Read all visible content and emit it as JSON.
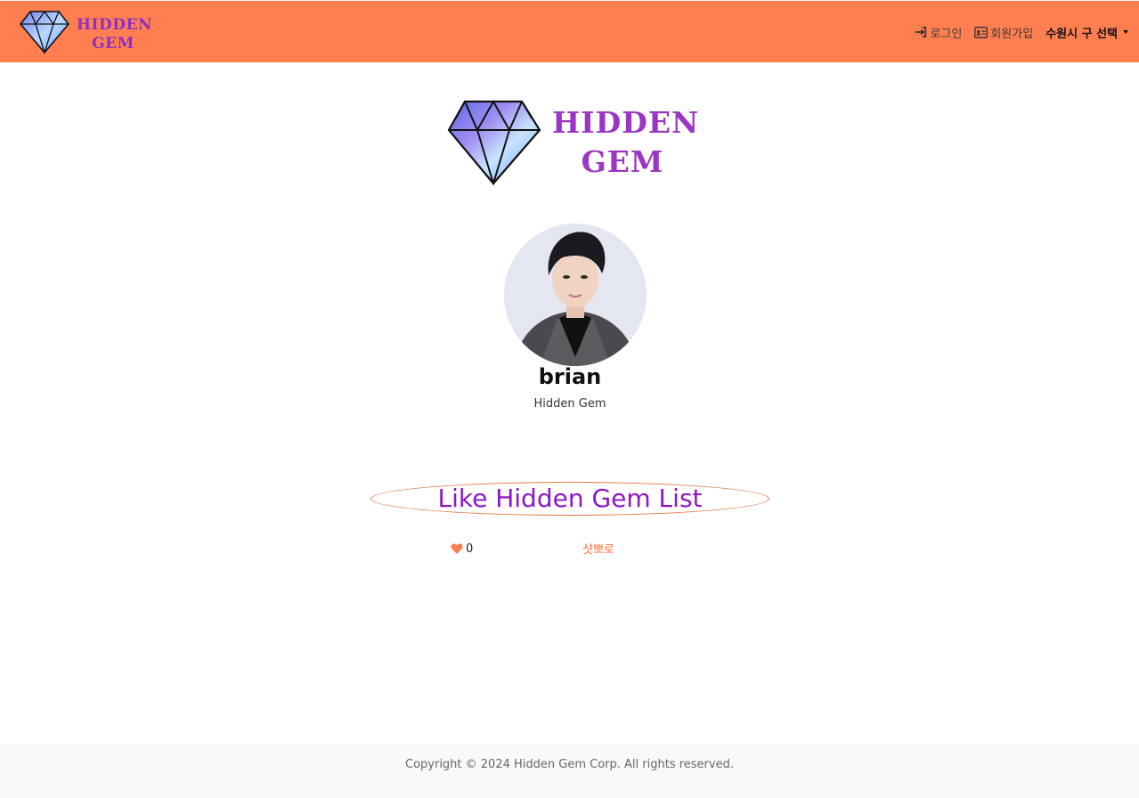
{
  "navbar": {
    "brand_text": "HIDDEN GEM",
    "login_label": "로그인",
    "signup_label": "회원가입",
    "city_select_label": "수원시 구 선택"
  },
  "logo": {
    "text": "HIDDEN GEM"
  },
  "profile": {
    "name": "brian",
    "subtitle": "Hidden Gem"
  },
  "list": {
    "title": "Like Hidden Gem List",
    "items": [
      {
        "like_count": "0",
        "store_name": "샷뽀로"
      }
    ]
  },
  "footer": {
    "copyright": "Copyright © 2024 Hidden Gem Corp. All rights reserved."
  },
  "colors": {
    "navbar_bg": "#ff7f50",
    "brand_purple": "#9b35c4",
    "list_title": "#8e17c8",
    "accent_orange": "#ff6d3a",
    "footer_bg": "#f8f9fa"
  }
}
